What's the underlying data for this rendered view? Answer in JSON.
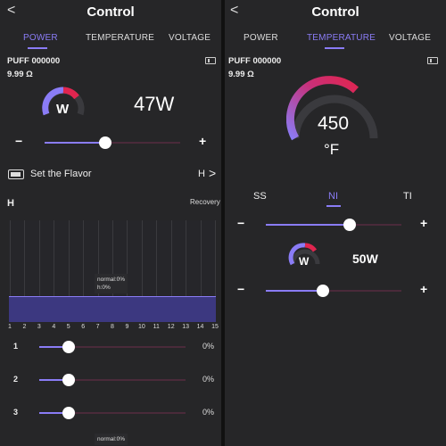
{
  "left": {
    "back": "<",
    "title": "Control",
    "tabs": [
      {
        "label": "POWER",
        "active": true
      },
      {
        "label": "TEMPERATURE",
        "active": false
      },
      {
        "label": "VOLTAGE",
        "active": false
      }
    ],
    "puff": "PUFF 000000",
    "resistance": "9.99 Ω",
    "gauge_unit": "W",
    "value": "47W",
    "minus": "−",
    "plus": "+",
    "power_slider_fraction": 0.45,
    "flavor_label": "Set the Flavor",
    "flavor_mode": "H",
    "flavor_chevron": ">",
    "curve_mode": "H",
    "recovery": "Recovery",
    "x_ticks": [
      "1",
      "2",
      "3",
      "4",
      "5",
      "6",
      "7",
      "8",
      "9",
      "10",
      "11",
      "12",
      "13",
      "14",
      "15"
    ],
    "tooltip_top": {
      "line1": "normal:0%",
      "line2": "h:0%"
    },
    "tooltip_bottom": "normal:0%",
    "rows": [
      {
        "label": "1",
        "pct": "0%",
        "fraction": 0.2
      },
      {
        "label": "2",
        "pct": "0%",
        "fraction": 0.2
      },
      {
        "label": "3",
        "pct": "0%",
        "fraction": 0.2
      }
    ]
  },
  "right": {
    "back": "<",
    "title": "Control",
    "tabs": [
      {
        "label": "POWER",
        "active": false
      },
      {
        "label": "TEMPERATURE",
        "active": true
      },
      {
        "label": "VOLTAGE",
        "active": false
      }
    ],
    "puff": "PUFF 000000",
    "resistance": "9.99 Ω",
    "temp_value": "450",
    "temp_unit": "°F",
    "modes": [
      {
        "label": "SS",
        "active": false
      },
      {
        "label": "NI",
        "active": true
      },
      {
        "label": "TI",
        "active": false
      }
    ],
    "minus": "−",
    "plus": "+",
    "temp_slider_fraction": 0.62,
    "watt_unit": "W",
    "watt_value": "50W",
    "watt_slider_fraction": 0.42
  },
  "colors": {
    "accent": "#8a7cf6",
    "gauge_red": "#e0254f",
    "track": "#4a2a3a",
    "band": "#3c3880"
  }
}
